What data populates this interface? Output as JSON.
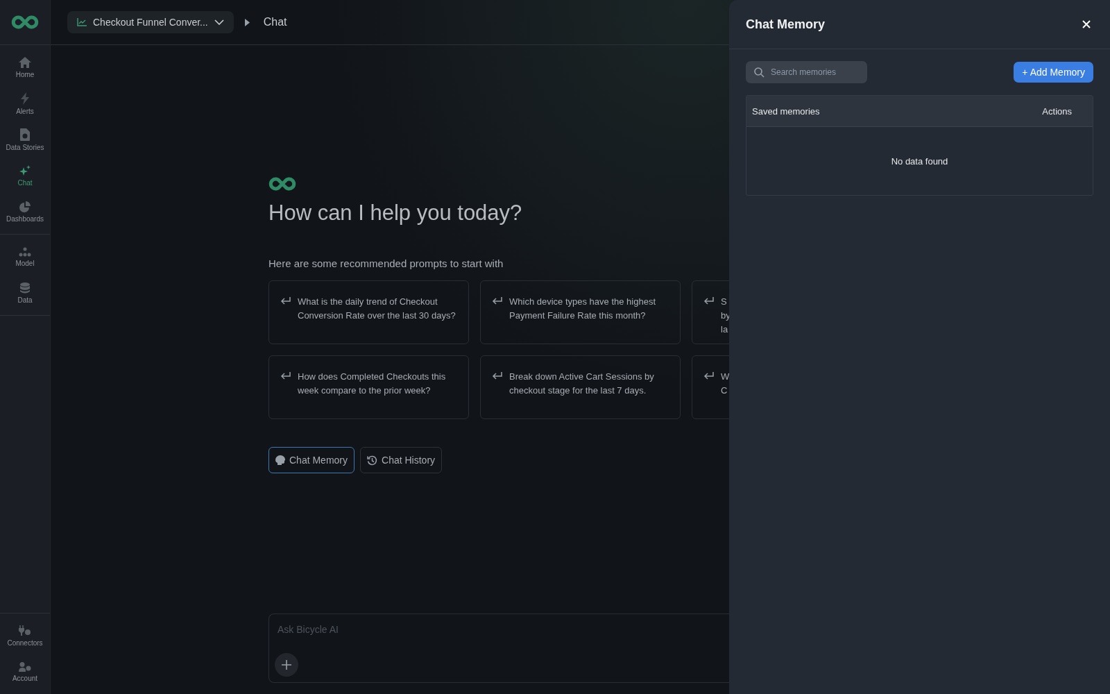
{
  "sidebar": {
    "groups": [
      {
        "items": [
          {
            "label": "Home",
            "selected": false
          },
          {
            "label": "Alerts",
            "selected": false
          },
          {
            "label": "Data Stories",
            "selected": false
          },
          {
            "label": "Chat",
            "selected": true
          },
          {
            "label": "Dashboards",
            "selected": false
          }
        ]
      },
      {
        "items": [
          {
            "label": "Model",
            "selected": false
          },
          {
            "label": "Data",
            "selected": false
          }
        ]
      },
      {
        "items": [
          {
            "label": "Connectors",
            "selected": false
          },
          {
            "label": "Account",
            "selected": false
          }
        ]
      }
    ]
  },
  "breadcrumb": {
    "dataset": "Checkout Funnel Conver...",
    "page": "Chat"
  },
  "welcome": {
    "heading": "How can I help you today?",
    "subheading": "Here are some recommended prompts to start with"
  },
  "prompts": [
    {
      "lines": [
        "What is the daily trend of Checkout Conversion Rate over the last 30 days?"
      ]
    },
    {
      "lines": [
        "Which device types have the highest Payment Failure Rate this month?"
      ]
    },
    {
      "lines": [
        "S",
        "by",
        "la"
      ]
    },
    {
      "lines": [
        "How does Completed Checkouts this week compare to the prior week?"
      ]
    },
    {
      "lines": [
        "Break down Active Cart Sessions by checkout stage for the last 7 days."
      ]
    },
    {
      "lines": [
        "W",
        "C"
      ]
    }
  ],
  "actions": [
    {
      "label": "Chat Memory",
      "selected": true
    },
    {
      "label": "Chat History",
      "selected": false
    }
  ],
  "composer": {
    "placeholder": "Ask Bicycle AI"
  },
  "panel": {
    "title": "Chat Memory",
    "search_placeholder": "Search memories",
    "add_button": "+ Add Memory",
    "table": {
      "columns": [
        "Saved memories",
        "Actions"
      ],
      "empty_text": "No data found"
    }
  }
}
